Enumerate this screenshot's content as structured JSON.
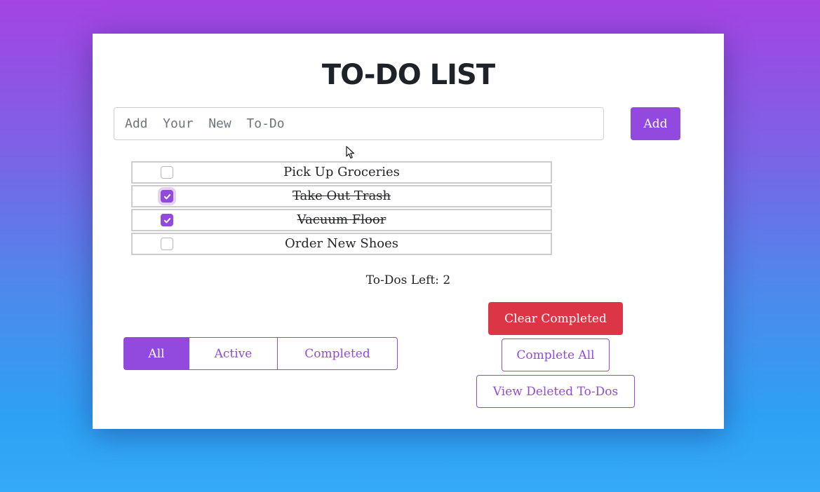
{
  "header": {
    "title": "TO-DO LIST"
  },
  "input": {
    "placeholder": "Add  Your  New  To-Do",
    "value": ""
  },
  "add_button": {
    "label": "Add"
  },
  "todos": [
    {
      "text": "Pick Up Groceries",
      "completed": false
    },
    {
      "text": "Take Out Trash",
      "completed": true
    },
    {
      "text": "Vacuum Floor",
      "completed": true
    },
    {
      "text": "Order New Shoes",
      "completed": false
    }
  ],
  "counter": {
    "text": "To-Dos Left: 2"
  },
  "filters": {
    "all": "All",
    "active": "Active",
    "completed": "Completed",
    "selected": "All"
  },
  "actions": {
    "clear_completed": "Clear Completed",
    "complete_all": "Complete All",
    "view_deleted": "View Deleted To-Dos"
  },
  "colors": {
    "accent": "#9149de",
    "danger": "#dc3545"
  }
}
